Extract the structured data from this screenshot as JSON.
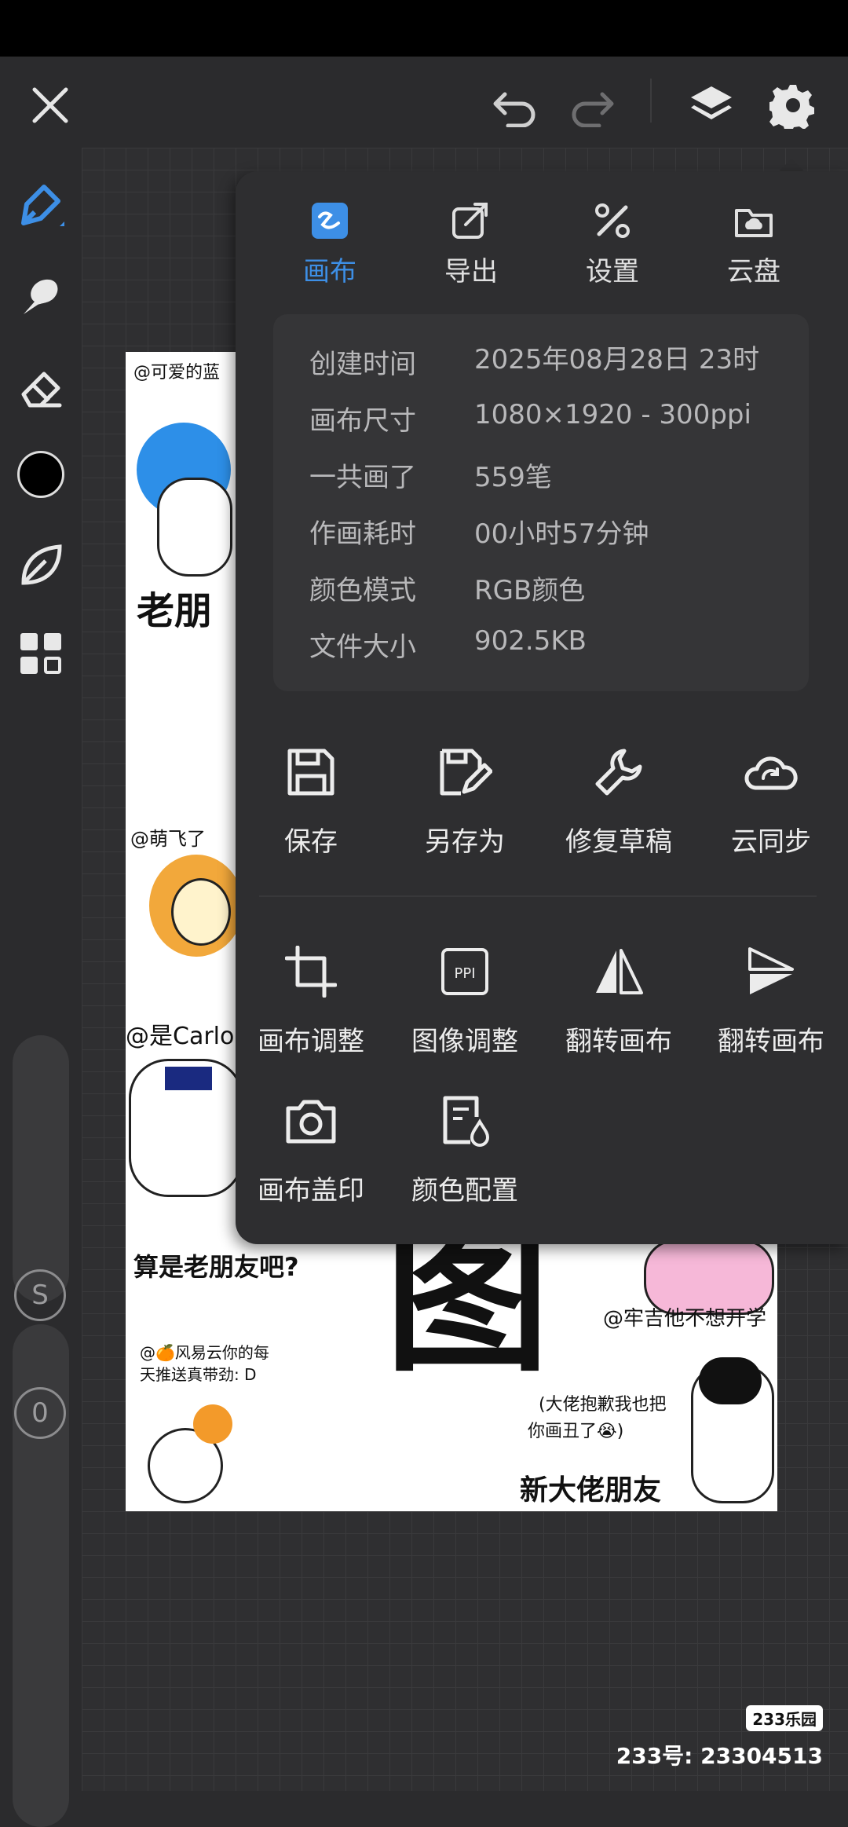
{
  "tabs": [
    {
      "label": "画布",
      "icon": "canvas-icon",
      "active": true
    },
    {
      "label": "导出",
      "icon": "export-icon",
      "active": false
    },
    {
      "label": "设置",
      "icon": "settings-tools-icon",
      "active": false
    },
    {
      "label": "云盘",
      "icon": "cloud-drive-icon",
      "active": false
    }
  ],
  "info": [
    {
      "label": "创建时间",
      "value": "2025年08月28日 23时"
    },
    {
      "label": "画布尺寸",
      "value": "1080×1920 - 300ppi"
    },
    {
      "label": "一共画了",
      "value": "559笔"
    },
    {
      "label": "作画耗时",
      "value": "00小时57分钟"
    },
    {
      "label": "颜色模式",
      "value": "RGB颜色"
    },
    {
      "label": "文件大小",
      "value": "902.5KB"
    }
  ],
  "actions": [
    {
      "label": "保存",
      "icon": "save-icon"
    },
    {
      "label": "另存为",
      "icon": "save-as-icon"
    },
    {
      "label": "修复草稿",
      "icon": "wrench-icon"
    },
    {
      "label": "云同步",
      "icon": "cloud-sync-icon"
    },
    {
      "label": "画布调整",
      "icon": "crop-icon"
    },
    {
      "label": "图像调整",
      "icon": "ppi-icon"
    },
    {
      "label": "翻转画布",
      "icon": "flip-horizontal-icon"
    },
    {
      "label": "翻转画布",
      "icon": "flip-vertical-icon"
    },
    {
      "label": "画布盖印",
      "icon": "camera-icon"
    },
    {
      "label": "颜色配置",
      "icon": "color-profile-icon"
    }
  ],
  "sliders": {
    "size_label": "S",
    "opacity_label": "0"
  },
  "accent_color": "#3d8fe6",
  "artwork_text": {
    "t1": "@可爱的蓝",
    "t2": "老朋",
    "t3": "@萌飞了",
    "t4": "@是Carlo",
    "t5": "算是老朋友吧?",
    "t6": "@牢吉他不想开学",
    "t7": "@🍊风易云你的每",
    "t8": "天推送真带劲: D",
    "t9": "(大佬抱歉我也把",
    "t10": "你画丑了😭)",
    "t11": "新大佬朋友",
    "t12": "图"
  },
  "watermark": {
    "logo": "233乐园",
    "id_text": "233号: 23304513"
  }
}
